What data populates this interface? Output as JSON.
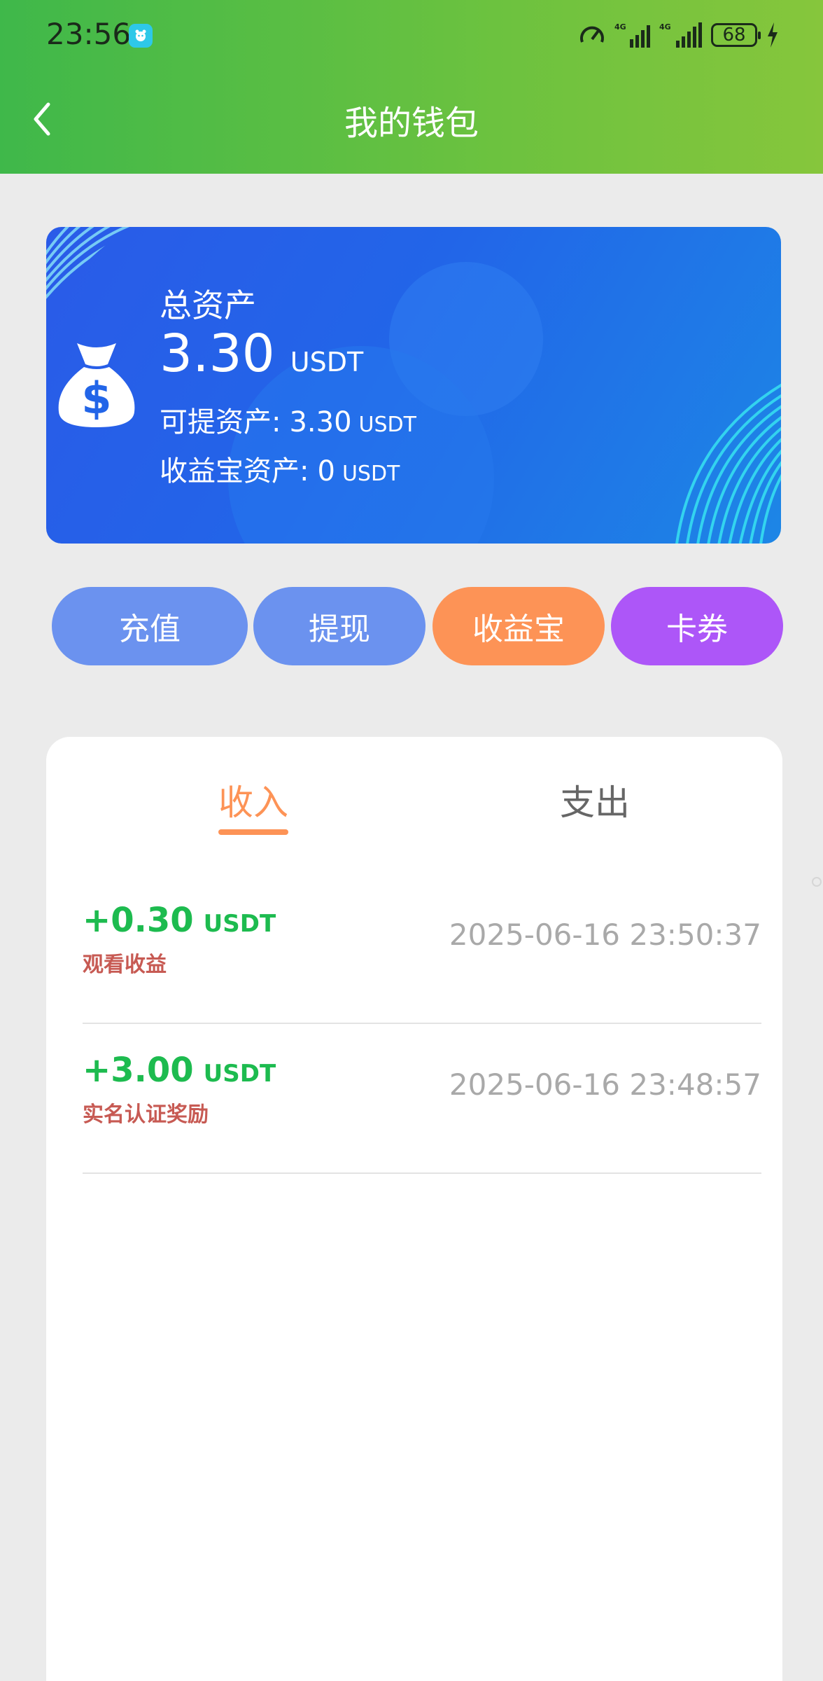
{
  "status_bar": {
    "time": "23:56",
    "battery": "68",
    "network_1": "4G",
    "network_2": "4G"
  },
  "header": {
    "title": "我的钱包",
    "back_icon": "chevron-left-icon"
  },
  "asset_card": {
    "label": "总资产",
    "total": "3.30",
    "total_unit": "USDT",
    "withdrawable_label": "可提资产:",
    "withdrawable_value": "3.30",
    "withdrawable_unit": "USDT",
    "yield_label": "收益宝资产:",
    "yield_value": "0",
    "yield_unit": "USDT",
    "icon": "money-bag-icon"
  },
  "actions": {
    "recharge": "充值",
    "withdraw": "提现",
    "yield": "收益宝",
    "coupon": "卡券"
  },
  "tabs": {
    "income": "收入",
    "expense": "支出"
  },
  "records": [
    {
      "amount": "+0.30",
      "unit": "USDT",
      "desc": "观看收益",
      "time": "2025-06-16 23:50:37"
    },
    {
      "amount": "+3.00",
      "unit": "USDT",
      "desc": "实名认证奖励",
      "time": "2025-06-16 23:48:57"
    }
  ],
  "colors": {
    "header_start": "#3fb84a",
    "header_end": "#86c63c",
    "card_blue": "#2265e8",
    "action_blue": "#6b92ef",
    "action_orange": "#fd9356",
    "action_purple": "#ad56f8",
    "amount_green": "#1dbb4f",
    "desc_red": "#c75a53"
  }
}
